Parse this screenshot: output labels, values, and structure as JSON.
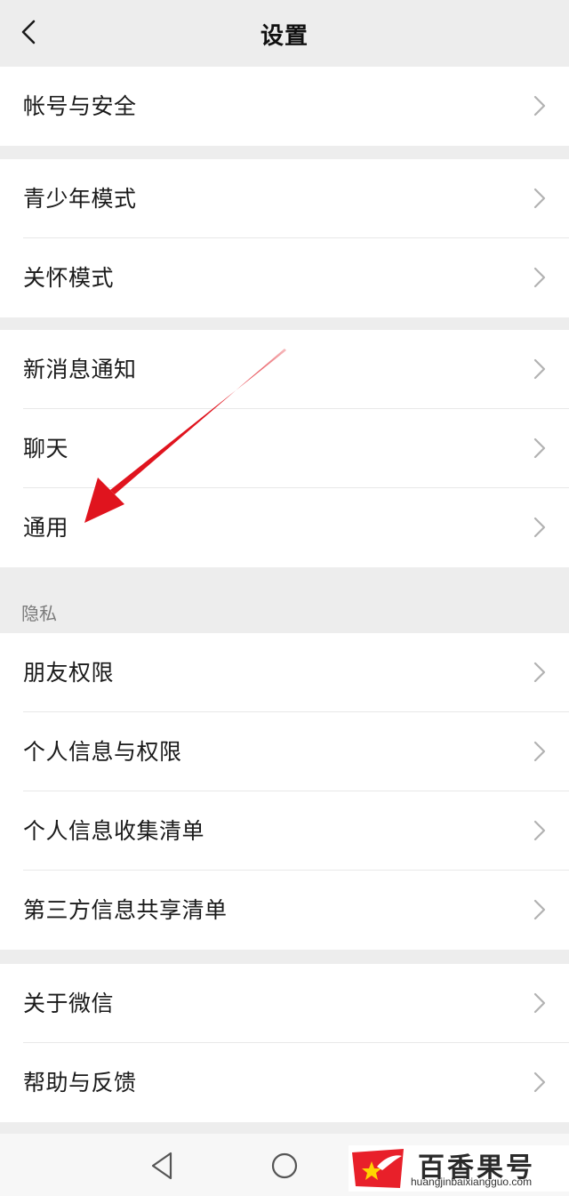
{
  "header": {
    "title": "设置",
    "back_icon": "chevron-left-icon"
  },
  "groups": [
    {
      "items": [
        {
          "label": "帐号与安全"
        }
      ]
    },
    {
      "items": [
        {
          "label": "青少年模式"
        },
        {
          "label": "关怀模式"
        }
      ]
    },
    {
      "items": [
        {
          "label": "新消息通知"
        },
        {
          "label": "聊天"
        },
        {
          "label": "通用"
        }
      ]
    },
    {
      "section_title": "隐私",
      "items": [
        {
          "label": "朋友权限"
        },
        {
          "label": "个人信息与权限"
        },
        {
          "label": "个人信息收集清单"
        },
        {
          "label": "第三方信息共享清单"
        }
      ]
    },
    {
      "items": [
        {
          "label": "关于微信"
        },
        {
          "label": "帮助与反馈"
        }
      ]
    }
  ],
  "annotation": {
    "type": "red-arrow",
    "points_to": "通用",
    "color": "#e0141e"
  },
  "navbar": {
    "icons": [
      "back-triangle-icon",
      "home-circle-icon"
    ]
  },
  "watermark": {
    "brand": "百香果号",
    "url": "huangjinbaixiangguo.com"
  },
  "colors": {
    "background": "#ededed",
    "card": "#ffffff",
    "text": "#1a1a1a",
    "chevron": "#b2b2b2"
  }
}
